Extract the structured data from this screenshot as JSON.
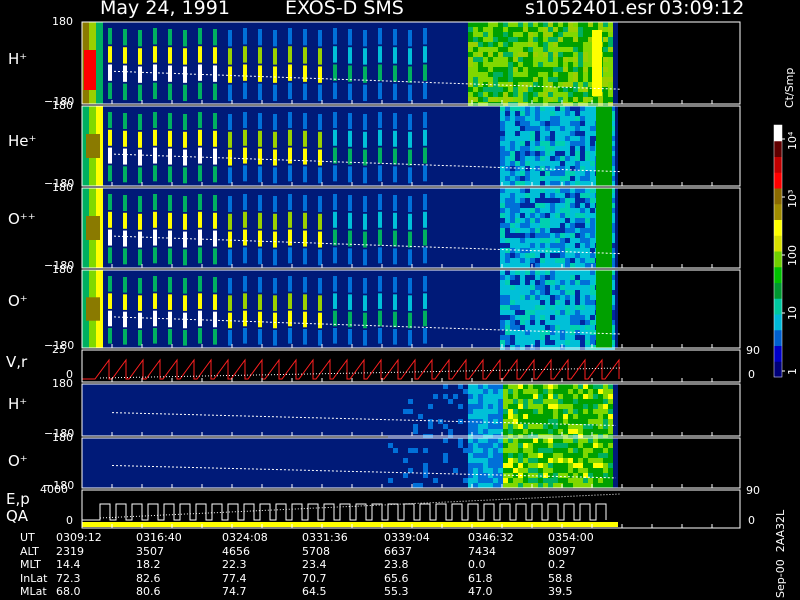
{
  "header": {
    "date": "May 24, 1991",
    "instrument": "EXOS-D SMS",
    "file": "s1052401.esr",
    "time": "03:09:12"
  },
  "colorbar": {
    "title": "Ct/Smp",
    "tick_labels": [
      "1",
      "10",
      "100",
      "10³",
      "10⁴"
    ],
    "tick_values": [
      1,
      10,
      100,
      1000,
      10000
    ],
    "colors": [
      "#00007a",
      "#0000c8",
      "#0060d0",
      "#00b8d8",
      "#00c8a0",
      "#009830",
      "#00c000",
      "#70d000",
      "#d8e000",
      "#ffff00",
      "#a08c00",
      "#8a6a00",
      "#ff0000",
      "#c00000",
      "#600000",
      "#ffffff"
    ]
  },
  "chart_data": [
    {
      "type": "heatmap",
      "panel": "H⁺",
      "ylabel": "H⁺",
      "y_ticks": [
        "180",
        "−180"
      ],
      "ylim": [
        -180,
        180
      ]
    },
    {
      "type": "heatmap",
      "panel": "He⁺",
      "ylabel": "He⁺",
      "y_ticks": [
        "180",
        "−180"
      ],
      "ylim": [
        -180,
        180
      ]
    },
    {
      "type": "heatmap",
      "panel": "O⁺⁺",
      "ylabel": "O⁺⁺",
      "y_ticks": [
        "180",
        "−180"
      ],
      "ylim": [
        -180,
        180
      ]
    },
    {
      "type": "heatmap",
      "panel": "O⁺",
      "ylabel": "O⁺",
      "y_ticks": [
        "180",
        "−180"
      ],
      "ylim": [
        -180,
        180
      ]
    },
    {
      "type": "line",
      "panel": "V,r",
      "ylabel": "V,r",
      "y_ticks": [
        "25",
        "0"
      ],
      "right_ticks": [
        "90",
        "0"
      ]
    },
    {
      "type": "heatmap",
      "panel": "H⁺ (2)",
      "ylabel": "H⁺",
      "y_ticks": [
        "180",
        "−180"
      ],
      "ylim": [
        -180,
        180
      ]
    },
    {
      "type": "heatmap",
      "panel": "O⁺ (2)",
      "ylabel": "O⁺",
      "y_ticks": [
        "180",
        "−180"
      ],
      "ylim": [
        -180,
        180
      ]
    },
    {
      "type": "line",
      "panel": "E,p / QA",
      "ylabel": "E,p",
      "ylabel2": "QA",
      "y_ticks": [
        "4000",
        "0"
      ],
      "right_ticks": [
        "90",
        "0"
      ]
    }
  ],
  "ephemeris": {
    "rows": [
      {
        "name": "UT",
        "values": [
          "0309:12",
          "0316:40",
          "0324:08",
          "0331:36",
          "0339:04",
          "0346:32",
          "0354:00"
        ]
      },
      {
        "name": "ALT",
        "values": [
          "2319",
          "3507",
          "4656",
          "5708",
          "6637",
          "7434",
          "8097"
        ]
      },
      {
        "name": "MLT",
        "values": [
          "14.4",
          "18.2",
          "22.3",
          "23.4",
          "23.8",
          "0.0",
          "0.2"
        ]
      },
      {
        "name": "InLat",
        "values": [
          "72.3",
          "82.6",
          "77.4",
          "70.7",
          "65.6",
          "61.8",
          "58.8"
        ]
      },
      {
        "name": "MLat",
        "values": [
          "68.0",
          "80.6",
          "74.7",
          "64.5",
          "55.3",
          "47.0",
          "39.5"
        ]
      }
    ]
  },
  "footer": {
    "stamp": "Sep-00  2AA32L"
  }
}
